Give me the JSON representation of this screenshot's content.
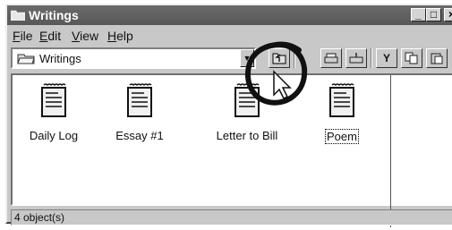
{
  "window": {
    "title": "Writings"
  },
  "menu": [
    {
      "accel": "F",
      "rest": "ile"
    },
    {
      "accel": "E",
      "rest": "dit"
    },
    {
      "accel": "V",
      "rest": "iew"
    },
    {
      "accel": "H",
      "rest": "elp"
    }
  ],
  "address": {
    "value": "Writings"
  },
  "files": [
    {
      "label": "Daily Log"
    },
    {
      "label": "Essay #1"
    },
    {
      "label": "Letter to Bill"
    },
    {
      "label": "Poem"
    }
  ],
  "status": {
    "text": "4 object(s)"
  },
  "icons": {
    "folder": "folder-icon",
    "up_one_level": "up-one-level-icon",
    "document": "document-icon",
    "cut": "cut-icon",
    "copy": "copy-icon",
    "paste": "paste-icon",
    "minimize": "minimize-icon",
    "maximize": "maximize-icon",
    "close": "close-icon"
  }
}
